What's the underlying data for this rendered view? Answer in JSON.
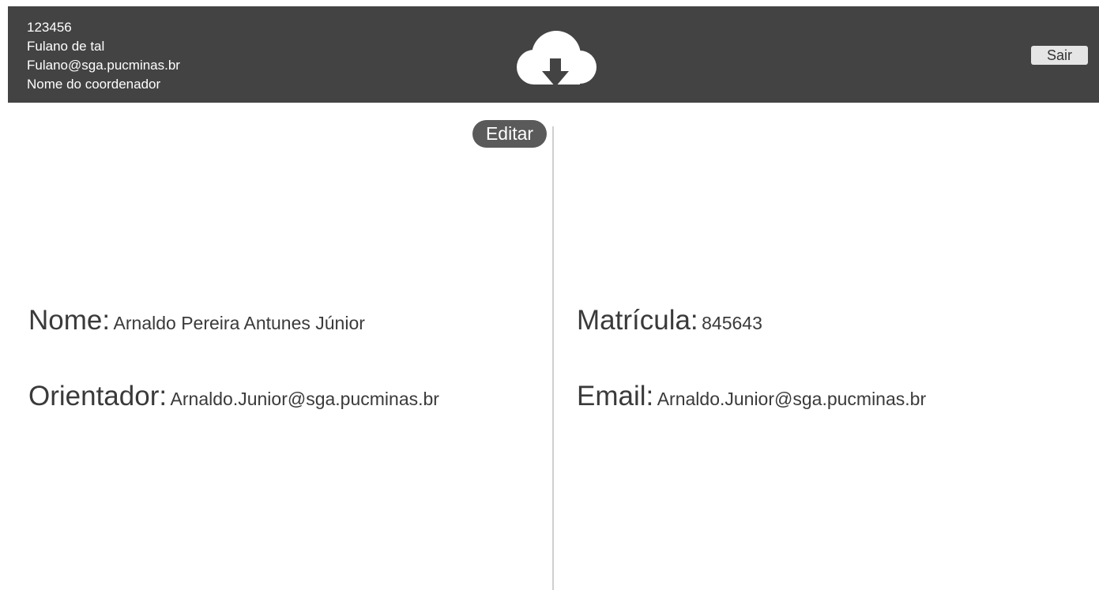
{
  "header": {
    "user_id": "123456",
    "user_name": "Fulano de tal",
    "user_email": "Fulano@sga.pucminas.br",
    "coordinator": "Nome do coordenador",
    "logout_label": "Sair",
    "logo_icon": "cloud-download-icon",
    "background_color": "#434343"
  },
  "actions": {
    "edit_label": "Editar"
  },
  "profile": {
    "name_label": "Nome:",
    "name_value": "Arnaldo Pereira Antunes Júnior",
    "advisor_label": "Orientador:",
    "advisor_value": "Arnaldo.Junior@sga.pucminas.br",
    "registration_label": "Matrícula:",
    "registration_value": "845643",
    "email_label": "Email:",
    "email_value": "Arnaldo.Junior@sga.pucminas.br"
  }
}
